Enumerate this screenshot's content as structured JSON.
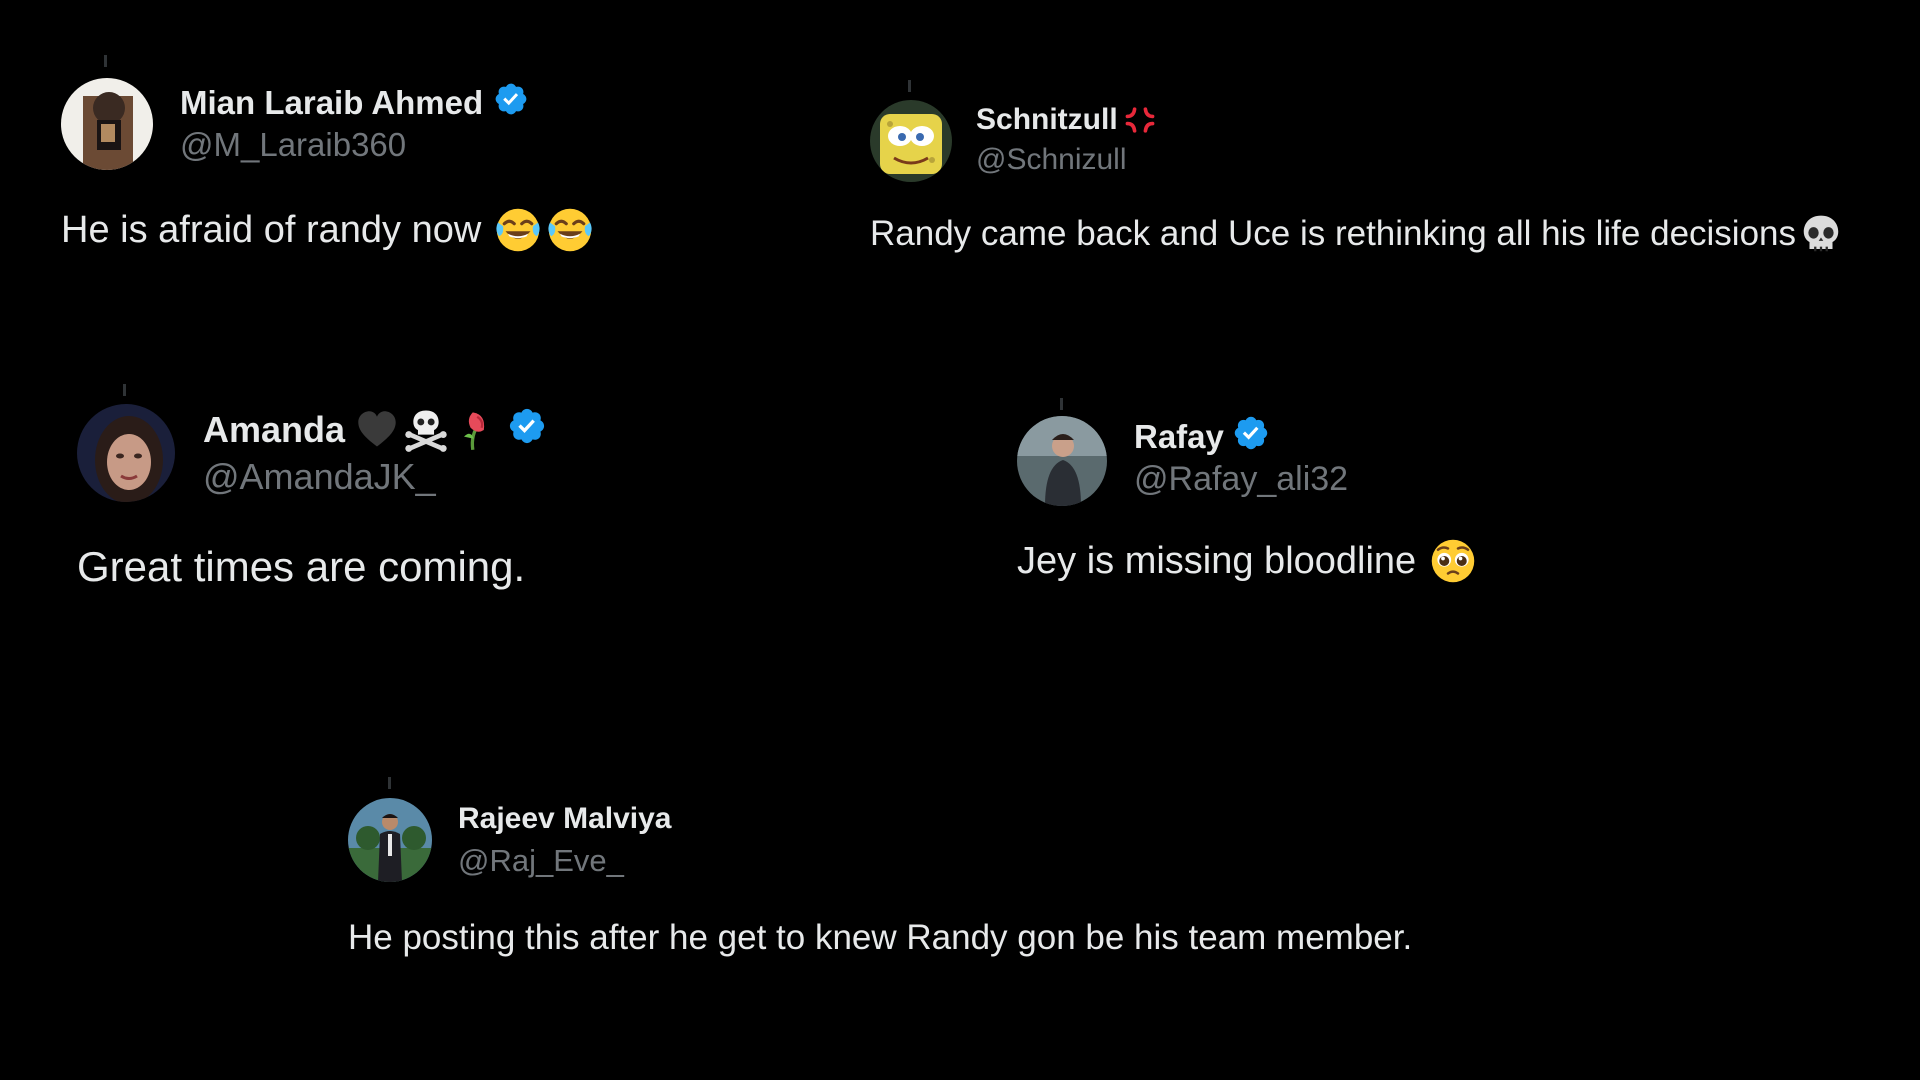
{
  "tweets": [
    {
      "display_name": "Mian Laraib Ahmed",
      "handle": "@M_Laraib360",
      "verified": true,
      "text": "He is afraid of randy now",
      "emoji": [
        "face-with-tears-of-joy",
        "face-with-tears-of-joy"
      ]
    },
    {
      "display_name": "Schnitzull",
      "name_emoji": [
        "anger-symbol"
      ],
      "handle": "@Schnizull",
      "verified": false,
      "text": "Randy came back and Uce is rethinking all his life decisions",
      "emoji": [
        "skull"
      ]
    },
    {
      "display_name": "Amanda",
      "name_emoji": [
        "black-heart",
        "skull-and-crossbones",
        "wilted-flower"
      ],
      "handle": "@AmandaJK_",
      "verified": true,
      "text": "Great times are coming."
    },
    {
      "display_name": "Rafay",
      "handle": "@Rafay_ali32",
      "verified": true,
      "text": "Jey is missing bloodline",
      "emoji": [
        "pleading-face"
      ]
    },
    {
      "display_name": "Rajeev Malviya",
      "handle": "@Raj_Eve_",
      "verified": false,
      "text": "He posting this after he get to knew Randy gon be his team member."
    }
  ],
  "colors": {
    "background": "#000000",
    "text": "#e7e9ea",
    "handle": "#71767b",
    "verified": "#1d9bf0"
  }
}
